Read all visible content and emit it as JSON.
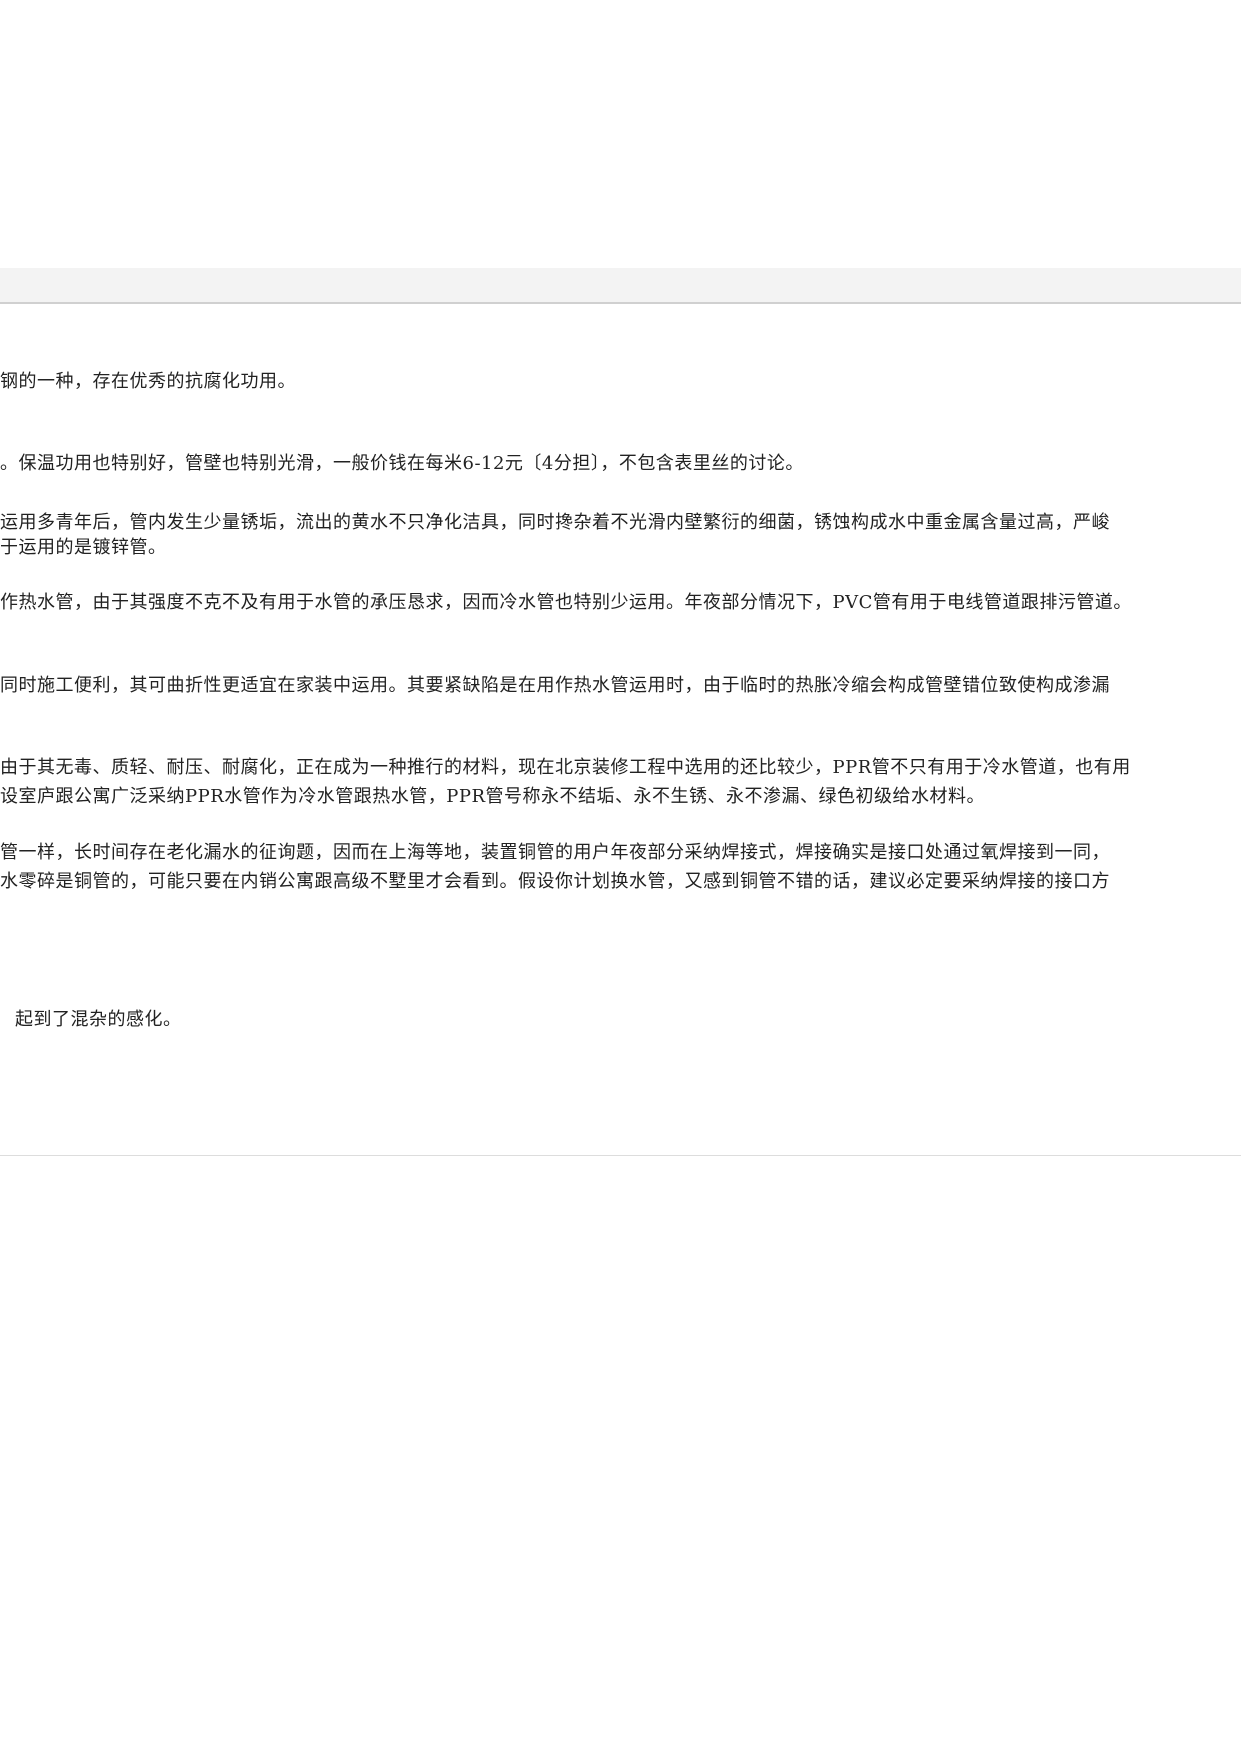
{
  "paragraphs": [
    {
      "lines": [
        "钢的一种，存在优秀的抗腐化功用。"
      ]
    },
    {
      "lines": [
        "。保温功用也特别好，管壁也特别光滑，一般价钱在每米6-12元〔4分担〕，不包含表里丝的讨论。"
      ]
    },
    {
      "lines": [
        "运用多青年后，管内发生少量锈垢，流出的黄水不只净化洁具，同时搀杂着不光滑内壁繁衍的细菌，锈蚀构成水中重金属含量过高，严峻",
        "于运用的是镀锌管。"
      ]
    },
    {
      "lines": [
        "作热水管，由于其强度不克不及有用于水管的承压恳求，因而冷水管也特别少运用。年夜部分情况下，PVC管有用于电线管道跟排污管道。"
      ]
    },
    {
      "lines": [
        "同时施工便利，其可曲折性更适宜在家装中运用。其要紧缺陷是在用作热水管运用时，由于临时的热胀冷缩会构成管壁错位致使构成渗漏"
      ]
    },
    {
      "lines": [
        "由于其无毒、质轻、耐压、耐腐化，正在成为一种推行的材料，现在北京装修工程中选用的还比较少，PPR管不只有用于冷水管道，也有用",
        "设室庐跟公寓广泛采纳PPR水管作为冷水管跟热水管，PPR管号称永不结垢、永不生锈、永不渗漏、绿色初级给水材料。"
      ]
    },
    {
      "lines": [
        "管一样，长时间存在老化漏水的征询题，因而在上海等地，装置铜管的用户年夜部分采纳焊接式，焊接确实是接口处通过氧焊接到一同，",
        "水零碎是铜管的，可能只要在内销公寓跟高级不墅里才会看到。假设你计划换水管，又感到铜管不错的话，建议必定要采纳焊接的接口方"
      ]
    },
    {
      "lines": [
        "起到了混杂的感化。"
      ]
    }
  ]
}
